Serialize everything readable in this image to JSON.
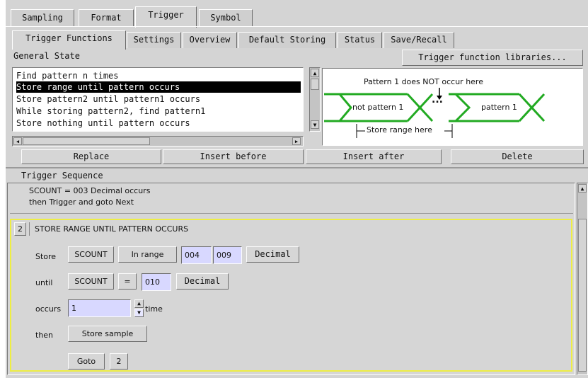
{
  "top_tabs": [
    "Sampling",
    "Format",
    "Trigger",
    "Symbol"
  ],
  "sub_tabs": [
    "Trigger Functions",
    "Settings",
    "Overview",
    "Default Storing",
    "Status",
    "Save/Recall"
  ],
  "general_state_label": "General State",
  "libraries_button": "Trigger function libraries...",
  "function_list": [
    "Find pattern n times",
    "Store range until pattern occurs",
    "Store pattern2 until pattern1 occurs",
    "While storing pattern2, find pattern1",
    "Store nothing until pattern occurs"
  ],
  "diagram": {
    "top_text": "Pattern 1 does NOT occur here",
    "left_label": "not pattern 1",
    "right_label": "pattern 1",
    "dots": "...",
    "bottom_text": "Store range here",
    "color": "#22aa22"
  },
  "action_buttons": [
    "Replace",
    "Insert before",
    "Insert after",
    "Delete"
  ],
  "sequence": {
    "title": "Trigger Sequence",
    "line1": "SCOUNT  =  003  Decimal  occurs",
    "line2": "then  Trigger and goto  Next",
    "step_number": "2",
    "step_title": "STORE RANGE UNTIL PATTERN OCCURS",
    "store_label": "Store",
    "store_counter": "SCOUNT",
    "in_range": "In range",
    "range_from": "004",
    "range_to": "009",
    "store_base": "Decimal",
    "until_label": "until",
    "until_counter": "SCOUNT",
    "until_op": "=",
    "until_value": "010",
    "until_base": "Decimal",
    "occurs_label": "occurs",
    "occurs_value": "1",
    "time_label": "time",
    "then_label": "then",
    "then_action": "Store sample",
    "goto_label": "Goto",
    "goto_target": "2"
  },
  "colors": {
    "highlight": "#eeee44",
    "field_bg": "#d8d8ff"
  }
}
